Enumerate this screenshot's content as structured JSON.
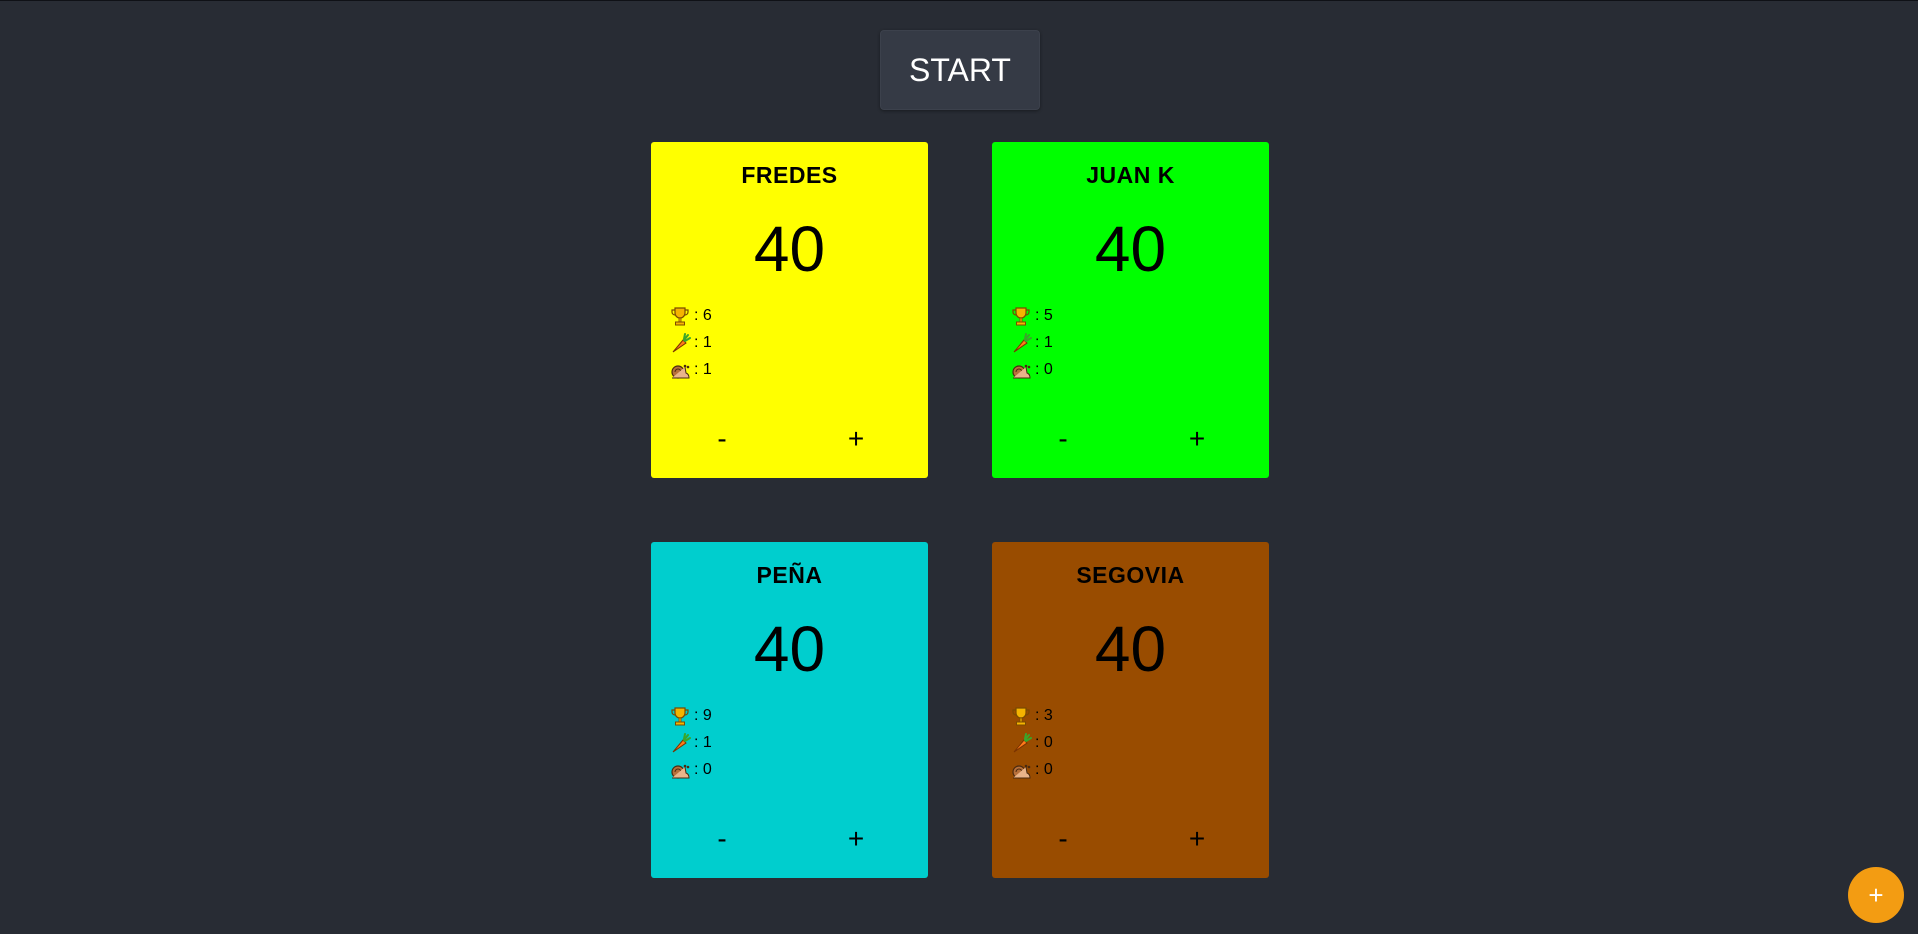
{
  "start_label": "START",
  "players": [
    {
      "name": "FREDES",
      "score": "40",
      "trophies": ": 6",
      "carrots": ": 1",
      "snails": ": 1",
      "color": "#ffff00",
      "minus": "-",
      "plus": "+"
    },
    {
      "name": "JUAN K",
      "score": "40",
      "trophies": ": 5",
      "carrots": ": 1",
      "snails": ": 0",
      "color": "#00ff00",
      "minus": "-",
      "plus": "+"
    },
    {
      "name": "PEÑA",
      "score": "40",
      "trophies": ": 9",
      "carrots": ": 1",
      "snails": ": 0",
      "color": "#00cece",
      "minus": "-",
      "plus": "+"
    },
    {
      "name": "SEGOVIA",
      "score": "40",
      "trophies": ": 3",
      "carrots": ": 0",
      "snails": ": 0",
      "color": "#994c00",
      "minus": "-",
      "plus": "+"
    }
  ],
  "icons": {
    "trophy": "trophy-icon",
    "carrot": "carrot-icon",
    "snail": "snail-icon"
  },
  "fab_label": "+",
  "colors": {
    "background": "#282c34",
    "fab": "#f39c12"
  }
}
